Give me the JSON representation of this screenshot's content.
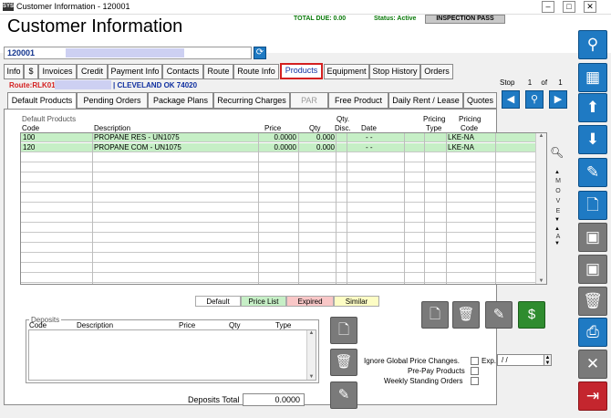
{
  "window": {
    "title": "Customer Information - 120001",
    "icon_text": "SYS"
  },
  "header": {
    "page_title": "Customer Information",
    "total_due": "TOTAL DUE:  0.00",
    "status": "Status:  Active",
    "inspection": "INSPECTION PASS"
  },
  "customer": {
    "id": "120001",
    "route": "Route:RLK01",
    "city": "| CLEVELAND OK 74020"
  },
  "tabs": [
    "Info",
    "$",
    "Invoices",
    "Credit",
    "Payment Info",
    "Contacts",
    "Route",
    "Route Info",
    "Products",
    "Equipment",
    "Stop History",
    "Orders"
  ],
  "active_tab": "Products",
  "stop": {
    "label": "Stop",
    "current": "1",
    "of": "of",
    "total": "1"
  },
  "subtabs": [
    "Default Products",
    "Pending Orders",
    "Package Plans",
    "Recurring Charges",
    "PAR",
    "Free Product",
    "Daily Rent / Lease",
    "Quotes"
  ],
  "grid": {
    "section_label": "Default Products",
    "columns": {
      "code": "Code",
      "description": "Description",
      "price": "Price",
      "qty": "Qty",
      "qty_disc_1": "Qty.",
      "qty_disc_2": "Disc.",
      "date": "Date",
      "pricing_type_1": "Pricing",
      "pricing_type_2": "Type",
      "pricing_code_1": "Pricing",
      "pricing_code_2": "Code"
    },
    "rows": [
      {
        "code": "100",
        "description": "PROPANE RES - UN1075",
        "price": "0.0000",
        "qty": "0.000",
        "date": "-     -",
        "pricing_code": "LKE-NA"
      },
      {
        "code": "120",
        "description": "PROPANE COM - UN1075",
        "price": "0.0000",
        "qty": "0.000",
        "date": "-     -",
        "pricing_code": "LKE-NA"
      }
    ]
  },
  "move_letters": [
    "M",
    "O",
    "V",
    "E"
  ],
  "sort_label": "A",
  "legend": [
    {
      "label": "Default",
      "color": "#ffffff"
    },
    {
      "label": "Price List",
      "color": "#c6efc6"
    },
    {
      "label": "Expired",
      "color": "#f9c7c7"
    },
    {
      "label": "Similar",
      "color": "#fdfdc4"
    }
  ],
  "deposits": {
    "title": "Deposits",
    "columns": {
      "code": "Code",
      "description": "Description",
      "price": "Price",
      "qty": "Qty",
      "type": "Type"
    },
    "total_label": "Deposits Total",
    "total_value": "0.0000"
  },
  "options": {
    "ignore_global": "Ignore Global Price Changes.",
    "exp_label": "Exp.",
    "exp_value": "/ /",
    "prepay": "Pre-Pay Products",
    "weekly": "Weekly Standing Orders"
  },
  "colors": {
    "accent_blue": "#1f7ac3",
    "active_tab_border": "#d42020",
    "price_list_green": "#c6efc6"
  },
  "sidebar_icons": [
    "search-icon",
    "grid-icon",
    "arrow-up-icon",
    "arrow-down-icon",
    "edit-icon",
    "new-document-icon",
    "add-icon",
    "save-icon",
    "delete-icon",
    "print-icon",
    "close-icon",
    "exit-icon"
  ]
}
